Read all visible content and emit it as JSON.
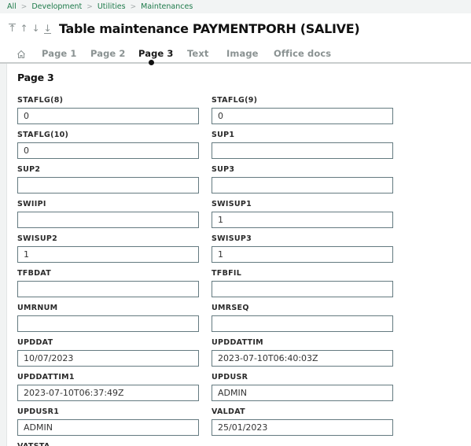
{
  "breadcrumb": [
    "All",
    "Development",
    "Utilities",
    "Maintenances"
  ],
  "title": "Table maintenance PAYMENTPORH (SALIVE)",
  "nav": {
    "first_icon": "arrow-to-top-icon",
    "prev_icon": "arrow-up-icon",
    "next_icon": "arrow-down-icon",
    "last_icon": "arrow-to-bottom-icon"
  },
  "tabs": {
    "home_icon": "home-icon",
    "items": [
      {
        "label": "Page 1",
        "active": false
      },
      {
        "label": "Page 2",
        "active": false
      },
      {
        "label": "Page 3",
        "active": true
      },
      {
        "label": "Text",
        "active": false
      },
      {
        "label": "Image",
        "active": false
      },
      {
        "label": "Office docs",
        "active": false
      }
    ]
  },
  "section": {
    "title": "Page 3"
  },
  "fields": [
    {
      "label": "STAFLG(8)",
      "value": "0"
    },
    {
      "label": "STAFLG(9)",
      "value": "0"
    },
    {
      "label": "STAFLG(10)",
      "value": "0"
    },
    {
      "label": "SUP1",
      "value": ""
    },
    {
      "label": "SUP2",
      "value": ""
    },
    {
      "label": "SUP3",
      "value": ""
    },
    {
      "label": "SWIIPI",
      "value": ""
    },
    {
      "label": "SWISUP1",
      "value": "1"
    },
    {
      "label": "SWISUP2",
      "value": "1"
    },
    {
      "label": "SWISUP3",
      "value": "1"
    },
    {
      "label": "TFBDAT",
      "value": ""
    },
    {
      "label": "TFBFIL",
      "value": ""
    },
    {
      "label": "UMRNUM",
      "value": ""
    },
    {
      "label": "UMRSEQ",
      "value": ""
    },
    {
      "label": "UPDDAT",
      "value": "10/07/2023"
    },
    {
      "label": "UPDDATTIM",
      "value": "2023-07-10T06:40:03Z"
    },
    {
      "label": "UPDDATTIM1",
      "value": "2023-07-10T06:37:49Z"
    },
    {
      "label": "UPDUSR",
      "value": "ADMIN"
    },
    {
      "label": "UPDUSR1",
      "value": "ADMIN"
    },
    {
      "label": "VALDAT",
      "value": "25/01/2023"
    },
    {
      "label": "VATSTA",
      "value": ""
    }
  ]
}
